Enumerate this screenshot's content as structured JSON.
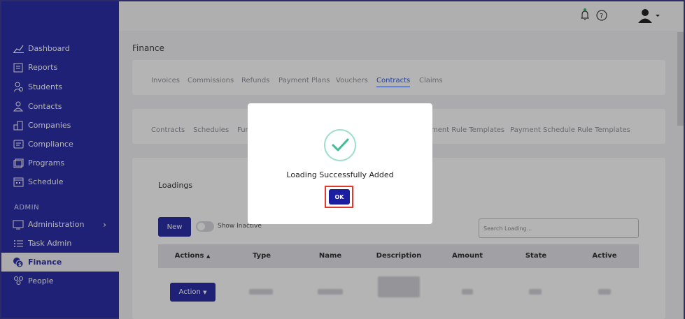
{
  "sidebar": {
    "items": [
      {
        "label": "Dashboard",
        "icon": "chart-line-icon"
      },
      {
        "label": "Reports",
        "icon": "report-icon"
      },
      {
        "label": "Students",
        "icon": "students-icon"
      },
      {
        "label": "Contacts",
        "icon": "contacts-icon"
      },
      {
        "label": "Companies",
        "icon": "companies-icon"
      },
      {
        "label": "Compliance",
        "icon": "compliance-icon"
      },
      {
        "label": "Programs",
        "icon": "programs-icon"
      },
      {
        "label": "Schedule",
        "icon": "calendar-icon"
      }
    ],
    "admin_heading": "ADMIN",
    "admin_items": [
      {
        "label": "Administration",
        "icon": "monitor-icon"
      },
      {
        "label": "Task Admin",
        "icon": "list-icon"
      },
      {
        "label": "Finance",
        "icon": "finance-icon"
      },
      {
        "label": "People",
        "icon": "people-icon"
      }
    ]
  },
  "page": {
    "title": "Finance"
  },
  "tabs": [
    "Invoices",
    "Commissions",
    "Refunds",
    "Payment Plans",
    "Vouchers",
    "Contracts",
    "Claims"
  ],
  "subtabs": [
    "Contracts",
    "Schedules",
    "Fun",
    "ment Rule Templates",
    "Payment Schedule Rule Templates"
  ],
  "loadings": {
    "title": "Loadings",
    "new_label": "New",
    "toggle_label": "Show Inactive",
    "search_placeholder": "Search Loading...",
    "columns": [
      "Actions",
      "Type",
      "Name",
      "Description",
      "Amount",
      "State",
      "Active"
    ],
    "action_label": "Action"
  },
  "modal": {
    "message": "Loading Successfully Added",
    "ok_label": "OK"
  },
  "colors": {
    "primary": "#1b1ea0",
    "success": "#3fbf8f",
    "highlight": "#e23b2e"
  }
}
